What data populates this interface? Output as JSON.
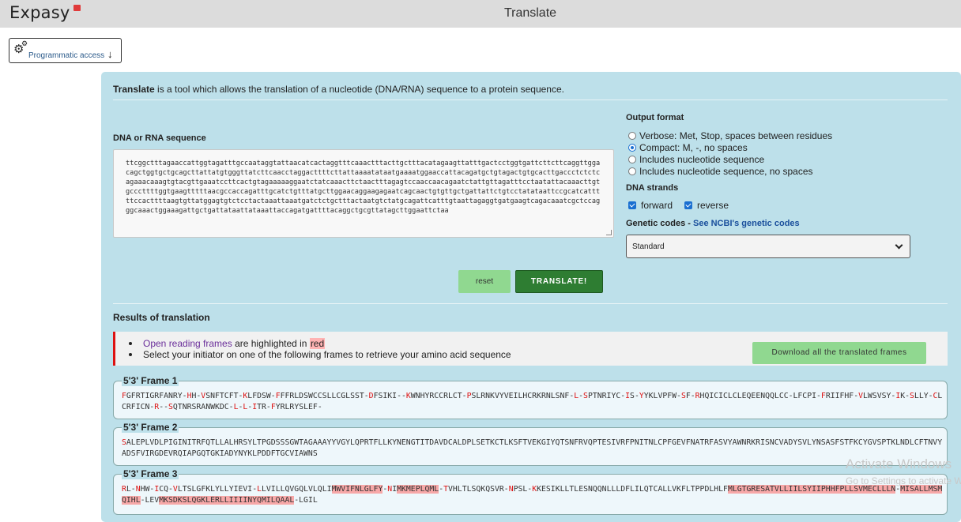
{
  "header": {
    "logo": "Expasy",
    "title": "Translate"
  },
  "programmatic": {
    "label": "Programmatic access"
  },
  "intro": {
    "tool": "Translate",
    "text": " is a tool which allows the translation of a nucleotide (DNA/RNA) sequence to a protein sequence."
  },
  "sequence": {
    "label": "DNA or RNA sequence",
    "value": "ttcggctttagaaccattggtagatttgccaataggtattaacatcactaggtttcaaactttacttgctttacatagaagttatttgactcctggtgattcttcttcaggttggacagctggtgctgcagcttattatgtgggttatcttcaacctaggacttttcttattaaaatataatgaaaatggaaccattacagatgctgtagactgtgcacttgaccctctctcagaaacaaagtgtacgttgaaatccttcactgtagaaaaaggaatctatcaaacttctaactttagagtccaaccaacagaatctattgttagatttcctaatattacaaacttgtgcccttttggtgaagtttttaacgccaccagatttgcatctgtttatgcttggaacaggaagagaatcagcaactgtgttgctgattattctgtcctatataattccgcatcatttttccacttttaagtgttatggagtgtctcctactaaattaaatgatctctgctttactaatgtctatgcagattcatttgtaattagaggtgatgaagtcagacaaatcgctccagggcaaactggaaagattgctgattataattataaattaccagatgattttacaggctgcgttatagcttggaattctaa"
  },
  "output": {
    "title": "Output format",
    "options": [
      "Verbose: Met, Stop, spaces between residues",
      "Compact: M, -, no spaces",
      "Includes nucleotide sequence",
      "Includes nucleotide sequence, no spaces"
    ],
    "selected": "Compact: M, -, no spaces"
  },
  "strands": {
    "title": "DNA strands",
    "forward": "forward",
    "reverse": "reverse"
  },
  "genetic": {
    "title": "Genetic codes - ",
    "link": "See NCBI's genetic codes",
    "selected": "Standard"
  },
  "buttons": {
    "reset": "reset",
    "translate": "TRANSLATE!",
    "download": "Download all the translated frames"
  },
  "results": {
    "title": "Results of translation",
    "notice1_link": "Open reading frames",
    "notice1_mid": " are highlighted in ",
    "notice1_red": "red",
    "notice2": "Select your initiator on one of the following frames to retrieve your amino acid sequence"
  },
  "frames": [
    {
      "title": "5'3' Frame 1"
    },
    {
      "title": "5'3' Frame 2"
    },
    {
      "title": "5'3' Frame 3"
    }
  ],
  "watermark": {
    "line1": "Activate Windows",
    "line2": "Go to Settings to activate Windows."
  },
  "colors": {
    "panel": "#bde0ea",
    "stop": "#dd1111",
    "orf": "#f7a8a8",
    "translate": "#2e7d32",
    "reset": "#90d890"
  }
}
